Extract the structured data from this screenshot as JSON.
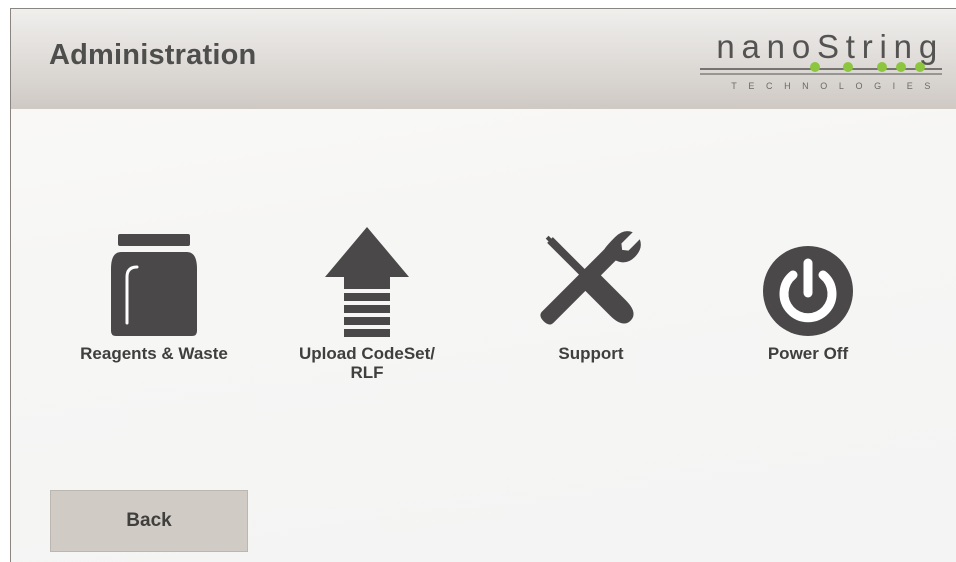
{
  "header": {
    "title": "Administration",
    "logo": {
      "word": "nanoString",
      "sub": "TECHNOLOGIES"
    }
  },
  "tiles": [
    {
      "label": "Reagents & Waste",
      "icon": "jar-icon"
    },
    {
      "label": "Upload CodeSet/\nRLF",
      "icon": "upload-arrow-icon"
    },
    {
      "label": "Support",
      "icon": "tools-icon"
    },
    {
      "label": "Power Off",
      "icon": "power-icon"
    }
  ],
  "footer": {
    "back_label": "Back"
  },
  "colors": {
    "icon": "#4a4848",
    "header": "#d9d5d1",
    "button": "#d1cbc5",
    "logo_dot": "#8cc63f"
  }
}
